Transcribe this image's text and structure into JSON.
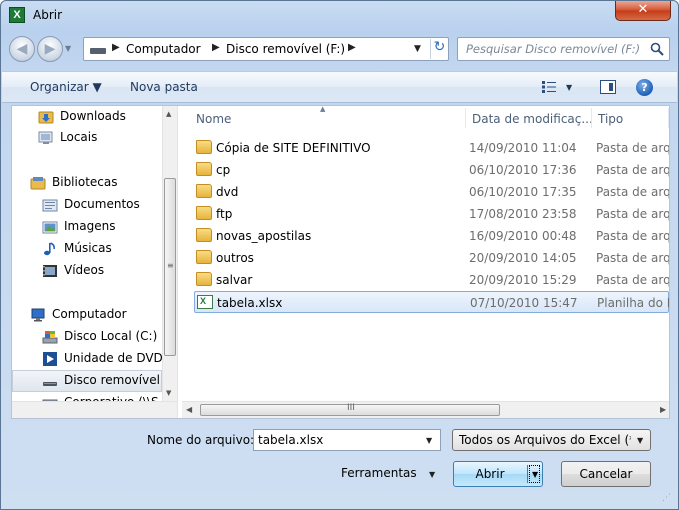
{
  "window": {
    "title": "Abrir",
    "close_glyph": "✕",
    "app_icon": "excel-icon",
    "app_icon_letter": "X"
  },
  "navbar": {
    "back_glyph": "◀",
    "forward_glyph": "▶",
    "history_glyph": "▼",
    "breadcrumbs": [
      "Computador",
      "Disco removível (F:)"
    ],
    "crumb_sep": "▶",
    "dropdown_glyph": "▼",
    "refresh_glyph": "↻",
    "search_placeholder": "Pesquisar Disco removível (F:)"
  },
  "toolbar": {
    "organize_label": "Organizar ▼",
    "new_folder_label": "Nova pasta",
    "views_dropdown_glyph": "▼",
    "help_glyph": "?"
  },
  "nav_pane": {
    "items": [
      {
        "label": "Downloads",
        "icon": "downloads-folder-icon",
        "indent": 2
      },
      {
        "label": "Locais",
        "icon": "recent-places-icon",
        "indent": 2
      },
      {
        "label": "Bibliotecas",
        "icon": "libraries-icon",
        "indent": 1
      },
      {
        "label": "Documentos",
        "icon": "documents-icon",
        "indent": 2
      },
      {
        "label": "Imagens",
        "icon": "pictures-icon",
        "indent": 2
      },
      {
        "label": "Músicas",
        "icon": "music-icon",
        "indent": 2
      },
      {
        "label": "Vídeos",
        "icon": "videos-icon",
        "indent": 2
      },
      {
        "label": "Computador",
        "icon": "computer-icon",
        "indent": 1
      },
      {
        "label": "Disco Local (C:)",
        "icon": "local-disk-icon",
        "indent": 2
      },
      {
        "label": "Unidade de DVD",
        "icon": "dvd-drive-icon",
        "indent": 2
      },
      {
        "label": "Disco removível",
        "icon": "removable-disk-icon",
        "indent": 2,
        "selected": true
      },
      {
        "label": "Corporativo (\\\\S",
        "icon": "network-drive-disconnected-icon",
        "indent": 2
      }
    ],
    "scroll_up": "▲",
    "scroll_down": "▼",
    "scroll_grip": "≡"
  },
  "file_list": {
    "columns": [
      {
        "label": "Nome"
      },
      {
        "label": "Data de modificaç..."
      },
      {
        "label": "Tipo"
      }
    ],
    "sort_glyph": "▲",
    "rows": [
      {
        "name": "Cópia de SITE DEFINITIVO",
        "date": "14/09/2010 11:04",
        "type": "Pasta de arquivos",
        "icon": "folder-icon"
      },
      {
        "name": "cp",
        "date": "06/10/2010 17:36",
        "type": "Pasta de arquivos",
        "icon": "folder-icon"
      },
      {
        "name": "dvd",
        "date": "06/10/2010 17:35",
        "type": "Pasta de arquivos",
        "icon": "folder-icon"
      },
      {
        "name": "ftp",
        "date": "17/08/2010 23:58",
        "type": "Pasta de arquivos",
        "icon": "folder-icon"
      },
      {
        "name": "novas_apostilas",
        "date": "16/09/2010 00:48",
        "type": "Pasta de arquivos",
        "icon": "folder-icon"
      },
      {
        "name": "outros",
        "date": "20/09/2010 14:05",
        "type": "Pasta de arquivos",
        "icon": "folder-icon"
      },
      {
        "name": "salvar",
        "date": "20/09/2010 15:29",
        "type": "Pasta de arquivos",
        "icon": "folder-icon"
      },
      {
        "name": "tabela.xlsx",
        "date": "07/10/2010 15:47",
        "type": "Planilha do Microsoft Excel",
        "icon": "excel-file-icon",
        "selected": true
      }
    ],
    "hscroll_left": "◀",
    "hscroll_right": "▶",
    "hscroll_grip": "III"
  },
  "footer": {
    "filename_label": "Nome do arquivo:",
    "filename_value": "tabela.xlsx",
    "dropdown_glyph": "▼",
    "filter_value": "Todos os Arquivos do Excel (*.xlsx;*.xlsm;*.xlsb;*.xls)",
    "tools_label": "Ferramentas",
    "open_label": "Abrir",
    "cancel_label": "Cancelar",
    "resize_glyph": "⋰"
  },
  "colors": {
    "accent": "#3c7fb1",
    "selection": "#d7e6f9",
    "folder": "#e7b43c",
    "excel": "#1f7a3a"
  }
}
